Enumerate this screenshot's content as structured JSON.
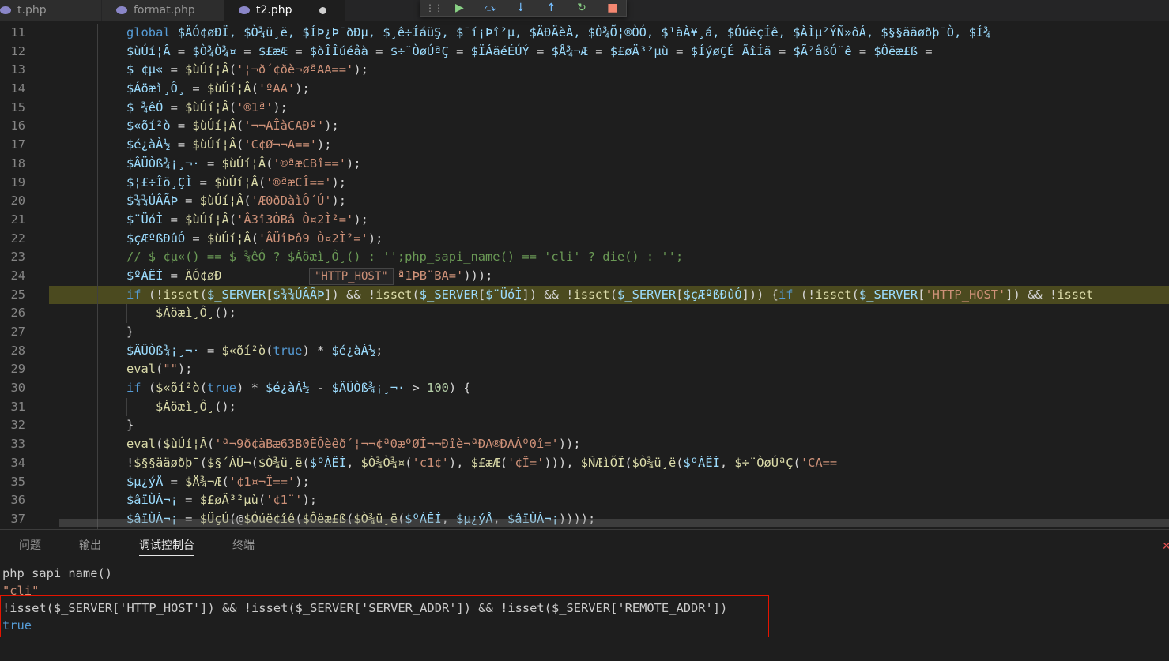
{
  "tabs": [
    {
      "label": "t.php",
      "active": false,
      "modified": false
    },
    {
      "label": "format.php",
      "active": false,
      "modified": false
    },
    {
      "label": "t2.php",
      "active": true,
      "modified": true
    }
  ],
  "debug_toolbar": [
    {
      "icon": "grip-icon",
      "glyph": "⋮⋮",
      "color": "#9a9a9a"
    },
    {
      "icon": "continue-icon",
      "glyph": "▶",
      "color": "#89d185"
    },
    {
      "icon": "step-over-icon",
      "glyph": "⤼",
      "color": "#75beff"
    },
    {
      "icon": "step-into-icon",
      "glyph": "↓",
      "color": "#75beff"
    },
    {
      "icon": "step-out-icon",
      "glyph": "↑",
      "color": "#75beff"
    },
    {
      "icon": "restart-icon",
      "glyph": "↻",
      "color": "#89d185"
    },
    {
      "icon": "stop-icon",
      "glyph": "■",
      "color": "#f48771"
    }
  ],
  "editor": {
    "lines": [
      {
        "no": "11",
        "indent": 1,
        "tokens": [
          [
            "k",
            "global "
          ],
          [
            "v",
            "$ÄÓ¢øÐÏ, $Ò¾ü¸ë, $ÍÞ¿Þ¯ðÐµ, $¸ê÷ÍáüŞ, $¯í¡Þî²µ, $ÄÐÄèÀ, $Ò¾Õ¦®ÒÓ, $¹ãÀ¥¸á, $ÓúëçÍê, $ÀÌµ²ÝÑ»ôÁ, $§§ääøðþ¯Ò, $Í¾"
          ]
        ]
      },
      {
        "no": "12",
        "indent": 1,
        "tokens": [
          [
            "v",
            "$ùÚí¦Â"
          ],
          [
            "p",
            " = "
          ],
          [
            "v",
            "$Ò¾Ò¾¤"
          ],
          [
            "p",
            " = "
          ],
          [
            "v",
            "$£æÆ"
          ],
          [
            "p",
            " = "
          ],
          [
            "v",
            "$òÎÎúéåà"
          ],
          [
            "p",
            " = "
          ],
          [
            "v",
            "$÷¨ÒøÚªÇ"
          ],
          [
            "p",
            " = "
          ],
          [
            "v",
            "$ÏÁäéÉÚÝ"
          ],
          [
            "p",
            " = "
          ],
          [
            "v",
            "$Å¾¬Æ"
          ],
          [
            "p",
            " = "
          ],
          [
            "v",
            "$£øÄ³²µù"
          ],
          [
            "p",
            " = "
          ],
          [
            "v",
            "$ÍýøÇÉ ÃîÍã"
          ],
          [
            "p",
            " = "
          ],
          [
            "v",
            "$Ã²åßÓ¨ê"
          ],
          [
            "p",
            " = "
          ],
          [
            "v",
            "$Ôëæ£ß"
          ],
          [
            "p",
            " ="
          ]
        ]
      },
      {
        "no": "13",
        "indent": 1,
        "tokens": [
          [
            "v",
            "$ ¢µ«"
          ],
          [
            "p",
            " = "
          ],
          [
            "f",
            "$ùÚí¦Â"
          ],
          [
            "p",
            "("
          ],
          [
            "s",
            "'¦¬ð´¢ðè¬øªAA=='"
          ],
          [
            "p",
            ");"
          ]
        ]
      },
      {
        "no": "14",
        "indent": 1,
        "tokens": [
          [
            "v",
            "$Áöæì¸Ô¸"
          ],
          [
            "p",
            " = "
          ],
          [
            "f",
            "$ùÚí¦Â"
          ],
          [
            "p",
            "("
          ],
          [
            "s",
            "'ºAA'"
          ],
          [
            "p",
            ");"
          ]
        ]
      },
      {
        "no": "15",
        "indent": 1,
        "tokens": [
          [
            "v",
            "$ ¾êÓ"
          ],
          [
            "p",
            " = "
          ],
          [
            "f",
            "$ùÚí¦Â"
          ],
          [
            "p",
            "("
          ],
          [
            "s",
            "'®1ª'"
          ],
          [
            "p",
            ");"
          ]
        ]
      },
      {
        "no": "16",
        "indent": 1,
        "tokens": [
          [
            "v",
            "$«õí²ò"
          ],
          [
            "p",
            " = "
          ],
          [
            "f",
            "$ùÚí¦Â"
          ],
          [
            "p",
            "("
          ],
          [
            "s",
            "'¬¬AÎàCAÐº'"
          ],
          [
            "p",
            ");"
          ]
        ]
      },
      {
        "no": "17",
        "indent": 1,
        "tokens": [
          [
            "v",
            "$é¿àÀ½"
          ],
          [
            "p",
            " = "
          ],
          [
            "f",
            "$ùÚí¦Â"
          ],
          [
            "p",
            "("
          ],
          [
            "s",
            "'C¢Ø¬¬A=='"
          ],
          [
            "p",
            ");"
          ]
        ]
      },
      {
        "no": "18",
        "indent": 1,
        "tokens": [
          [
            "v",
            "$ÂÜÒß¾¡¸¬·"
          ],
          [
            "p",
            " = "
          ],
          [
            "f",
            "$ùÚí¦Â"
          ],
          [
            "p",
            "("
          ],
          [
            "s",
            "'®ªæCBî=='"
          ],
          [
            "p",
            ");"
          ]
        ]
      },
      {
        "no": "19",
        "indent": 1,
        "tokens": [
          [
            "v",
            "$¦£÷Îö¸ÇÌ"
          ],
          [
            "p",
            " = "
          ],
          [
            "f",
            "$ùÚí¦Â"
          ],
          [
            "p",
            "("
          ],
          [
            "s",
            "'®ªæCÎ=='"
          ],
          [
            "p",
            ");"
          ]
        ]
      },
      {
        "no": "20",
        "indent": 1,
        "tokens": [
          [
            "v",
            "$¾¾ÚÂÃÞ"
          ],
          [
            "p",
            " = "
          ],
          [
            "f",
            "$ùÚí¦Â"
          ],
          [
            "p",
            "("
          ],
          [
            "s",
            "'Æ0ðDàìÔ´Ú'"
          ],
          [
            "p",
            ");"
          ]
        ]
      },
      {
        "no": "21",
        "indent": 1,
        "tokens": [
          [
            "v",
            "$¨ÜóÌ"
          ],
          [
            "p",
            " = "
          ],
          [
            "f",
            "$ùÚí¦Â"
          ],
          [
            "p",
            "("
          ],
          [
            "s",
            "'Â3î3ÒBâ Ò¤2Ì²='"
          ],
          [
            "p",
            ");"
          ]
        ]
      },
      {
        "no": "22",
        "indent": 1,
        "tokens": [
          [
            "v",
            "$çÆºßÐûÓ"
          ],
          [
            "p",
            " = "
          ],
          [
            "f",
            "$ùÚí¦Â"
          ],
          [
            "p",
            "("
          ],
          [
            "s",
            "'ÂÜîÞô9 Ò¤2Ì²='"
          ],
          [
            "p",
            ");"
          ]
        ]
      },
      {
        "no": "23",
        "indent": 1,
        "tokens": [
          [
            "c",
            "// $ ¢µ«() == $ ¾êÓ ? $Áöæì¸Ô¸() : '';php_sapi_name() == 'cli' ? die() : '';"
          ]
        ]
      },
      {
        "no": "24",
        "indent": 1,
        "tokens": [
          [
            "v",
            "$ºÁÊÍ"
          ],
          [
            "p",
            " = "
          ],
          [
            "f",
            "ÄÓ¢øÐ"
          ],
          [
            "p",
            "                 "
          ],
          [
            "f",
            "ùÚí¦Â"
          ],
          [
            "p",
            "("
          ],
          [
            "s",
            "'ª1ÞB¨BA='"
          ],
          [
            "p",
            ")));"
          ]
        ]
      },
      {
        "no": "25",
        "indent": 1,
        "hl": true,
        "tokens": [
          [
            "k",
            "if"
          ],
          [
            "p",
            " (!"
          ],
          [
            "f",
            "isset"
          ],
          [
            "p",
            "("
          ],
          [
            "v",
            "$_SERVER"
          ],
          [
            "p",
            "["
          ],
          [
            "v",
            "$¾¾ÚÂÃÞ"
          ],
          [
            "p",
            "]) && !"
          ],
          [
            "f",
            "isset"
          ],
          [
            "p",
            "("
          ],
          [
            "v",
            "$_SERVER"
          ],
          [
            "p",
            "["
          ],
          [
            "v",
            "$¨ÜóÌ"
          ],
          [
            "p",
            "]) && !"
          ],
          [
            "f",
            "isset"
          ],
          [
            "p",
            "("
          ],
          [
            "v",
            "$_SERVER"
          ],
          [
            "p",
            "["
          ],
          [
            "v",
            "$çÆºßÐûÓ"
          ],
          [
            "p",
            "])) {"
          ],
          [
            "k",
            "if"
          ],
          [
            "p",
            " (!"
          ],
          [
            "f",
            "isset"
          ],
          [
            "p",
            "("
          ],
          [
            "v",
            "$_SERVER"
          ],
          [
            "p",
            "["
          ],
          [
            "s",
            "'HTTP_HOST'"
          ],
          [
            "p",
            "]) && !"
          ],
          [
            "f",
            "isset"
          ]
        ]
      },
      {
        "no": "26",
        "indent": 2,
        "tokens": [
          [
            "f",
            "$Áöæì¸Ô¸"
          ],
          [
            "p",
            "();"
          ]
        ]
      },
      {
        "no": "27",
        "indent": 1,
        "tokens": [
          [
            "p",
            "}"
          ]
        ]
      },
      {
        "no": "28",
        "indent": 1,
        "tokens": [
          [
            "v",
            "$ÂÜÒß¾¡¸¬·"
          ],
          [
            "p",
            " = "
          ],
          [
            "f",
            "$«õí²ò"
          ],
          [
            "p",
            "("
          ],
          [
            "k",
            "true"
          ],
          [
            "p",
            ") * "
          ],
          [
            "v",
            "$é¿àÀ½"
          ],
          [
            "p",
            ";"
          ]
        ]
      },
      {
        "no": "29",
        "indent": 1,
        "tokens": [
          [
            "f",
            "eval"
          ],
          [
            "p",
            "("
          ],
          [
            "s",
            "\"\""
          ],
          [
            "p",
            ");"
          ]
        ]
      },
      {
        "no": "30",
        "indent": 1,
        "tokens": [
          [
            "k",
            "if"
          ],
          [
            "p",
            " ("
          ],
          [
            "f",
            "$«õí²ò"
          ],
          [
            "p",
            "("
          ],
          [
            "k",
            "true"
          ],
          [
            "p",
            ") * "
          ],
          [
            "v",
            "$é¿àÀ½"
          ],
          [
            "p",
            " - "
          ],
          [
            "v",
            "$ÂÜÒß¾¡¸¬·"
          ],
          [
            "p",
            " > "
          ],
          [
            "n",
            "100"
          ],
          [
            "p",
            ") {"
          ]
        ]
      },
      {
        "no": "31",
        "indent": 2,
        "tokens": [
          [
            "f",
            "$Áöæì¸Ô¸"
          ],
          [
            "p",
            "();"
          ]
        ]
      },
      {
        "no": "32",
        "indent": 1,
        "tokens": [
          [
            "p",
            "}"
          ]
        ]
      },
      {
        "no": "33",
        "indent": 1,
        "tokens": [
          [
            "f",
            "eval"
          ],
          [
            "p",
            "("
          ],
          [
            "f",
            "$ùÚí¦Â"
          ],
          [
            "p",
            "("
          ],
          [
            "s",
            "'ª¬9ð¢àBæ63B0ÈÔèêð´¦¬¬¢ª0æºØÎ¬¬Ðîè¬ªÐA®ÐAÂº0î='"
          ],
          [
            "p",
            "));"
          ]
        ]
      },
      {
        "no": "34",
        "indent": 1,
        "tokens": [
          [
            "p",
            "!"
          ],
          [
            "f",
            "$§§ääøðþ¯"
          ],
          [
            "p",
            "("
          ],
          [
            "f",
            "$§´ÁÙ¬"
          ],
          [
            "p",
            "("
          ],
          [
            "f",
            "$Ò¾ü¸ë"
          ],
          [
            "p",
            "("
          ],
          [
            "v",
            "$ºÁÊÍ"
          ],
          [
            "p",
            ", "
          ],
          [
            "f",
            "$Ò¾Ò¾¤"
          ],
          [
            "p",
            "("
          ],
          [
            "s",
            "'¢1¢'"
          ],
          [
            "p",
            "), "
          ],
          [
            "f",
            "$£æÆ"
          ],
          [
            "p",
            "("
          ],
          [
            "s",
            "'¢Î='"
          ],
          [
            "p",
            "))), "
          ],
          [
            "f",
            "$ÑÆìÕÎ"
          ],
          [
            "p",
            "("
          ],
          [
            "f",
            "$Ò¾ü¸ë"
          ],
          [
            "p",
            "("
          ],
          [
            "v",
            "$ºÁÊÍ"
          ],
          [
            "p",
            ", "
          ],
          [
            "f",
            "$÷¨ÒøÚªÇ"
          ],
          [
            "p",
            "("
          ],
          [
            "s",
            "'CA=="
          ]
        ]
      },
      {
        "no": "35",
        "indent": 1,
        "tokens": [
          [
            "v",
            "$µ¿ýÅ"
          ],
          [
            "p",
            " = "
          ],
          [
            "f",
            "$Å¾¬Æ"
          ],
          [
            "p",
            "("
          ],
          [
            "s",
            "'¢1¤¬Î=='"
          ],
          [
            "p",
            ");"
          ]
        ]
      },
      {
        "no": "36",
        "indent": 1,
        "tokens": [
          [
            "v",
            "$âïÙÂ¬¡"
          ],
          [
            "p",
            " = "
          ],
          [
            "f",
            "$£øÄ³²µù"
          ],
          [
            "p",
            "("
          ],
          [
            "s",
            "'¢1¨'"
          ],
          [
            "p",
            ");"
          ]
        ]
      },
      {
        "no": "37",
        "indent": 1,
        "tokens": [
          [
            "v",
            "$âïÙÂ¬¡"
          ],
          [
            "p",
            " = "
          ],
          [
            "f",
            "$ÜçÚ"
          ],
          [
            "p",
            "(@"
          ],
          [
            "f",
            "$Óúë¢îê"
          ],
          [
            "p",
            "("
          ],
          [
            "f",
            "$Ôëæ£ß"
          ],
          [
            "p",
            "("
          ],
          [
            "f",
            "$Ò¾ü¸ë"
          ],
          [
            "p",
            "("
          ],
          [
            "v",
            "$ºÁÊÍ"
          ],
          [
            "p",
            ", "
          ],
          [
            "v",
            "$µ¿ýÅ"
          ],
          [
            "p",
            ", "
          ],
          [
            "v",
            "$âïÙÂ¬¡"
          ],
          [
            "p",
            "))));"
          ]
        ]
      }
    ],
    "hover_tip": "\"HTTP_HOST\""
  },
  "panel": {
    "tabs": [
      {
        "label": "问题",
        "active": false
      },
      {
        "label": "输出",
        "active": false
      },
      {
        "label": "调试控制台",
        "active": true
      },
      {
        "label": "终端",
        "active": false
      }
    ],
    "console": [
      {
        "text": "php_sapi_name()",
        "kind": "out"
      },
      {
        "text": "\"cli\"",
        "kind": "res-str"
      },
      {
        "text": "!isset($_SERVER['HTTP_HOST']) && !isset($_SERVER['SERVER_ADDR']) && !isset($_SERVER['REMOTE_ADDR'])",
        "kind": "out"
      },
      {
        "text": "true",
        "kind": "res-bool"
      }
    ]
  },
  "colors": {
    "editor_bg": "#1e1e1e",
    "keyword": "#569cd6",
    "variable": "#9cdcfe",
    "string": "#ce9178",
    "function": "#dcdcaa",
    "number": "#b5cea8",
    "comment": "#6a9955",
    "highlight_line": "#4b4a1f",
    "annotation_box": "#e51400"
  }
}
